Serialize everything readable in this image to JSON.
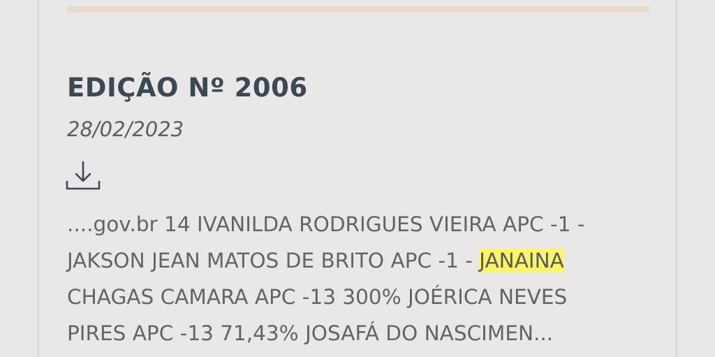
{
  "edition": {
    "title": "EDIÇÃO Nº 2006",
    "date": "28/02/2023"
  },
  "download": {
    "icon": "download-icon"
  },
  "excerpt": {
    "line1": "....gov.br 14 IVANILDA RODRIGUES VIEIRA APC -1 -",
    "line2_before": "JAKSON JEAN MATOS DE BRITO APC -1 - ",
    "line2_highlight": "JANAINA",
    "line3": "CHAGAS CAMARA APC -13 300% JOÉRICA NEVES",
    "line4": "PIRES APC -13 71,43% JOSAFÁ DO NASCIMEN..."
  },
  "colors": {
    "background": "#e9e7e8",
    "title": "#3b4a52",
    "text": "#646464",
    "highlight": "#fbf56a",
    "top_rule": "#e4dbcc"
  }
}
